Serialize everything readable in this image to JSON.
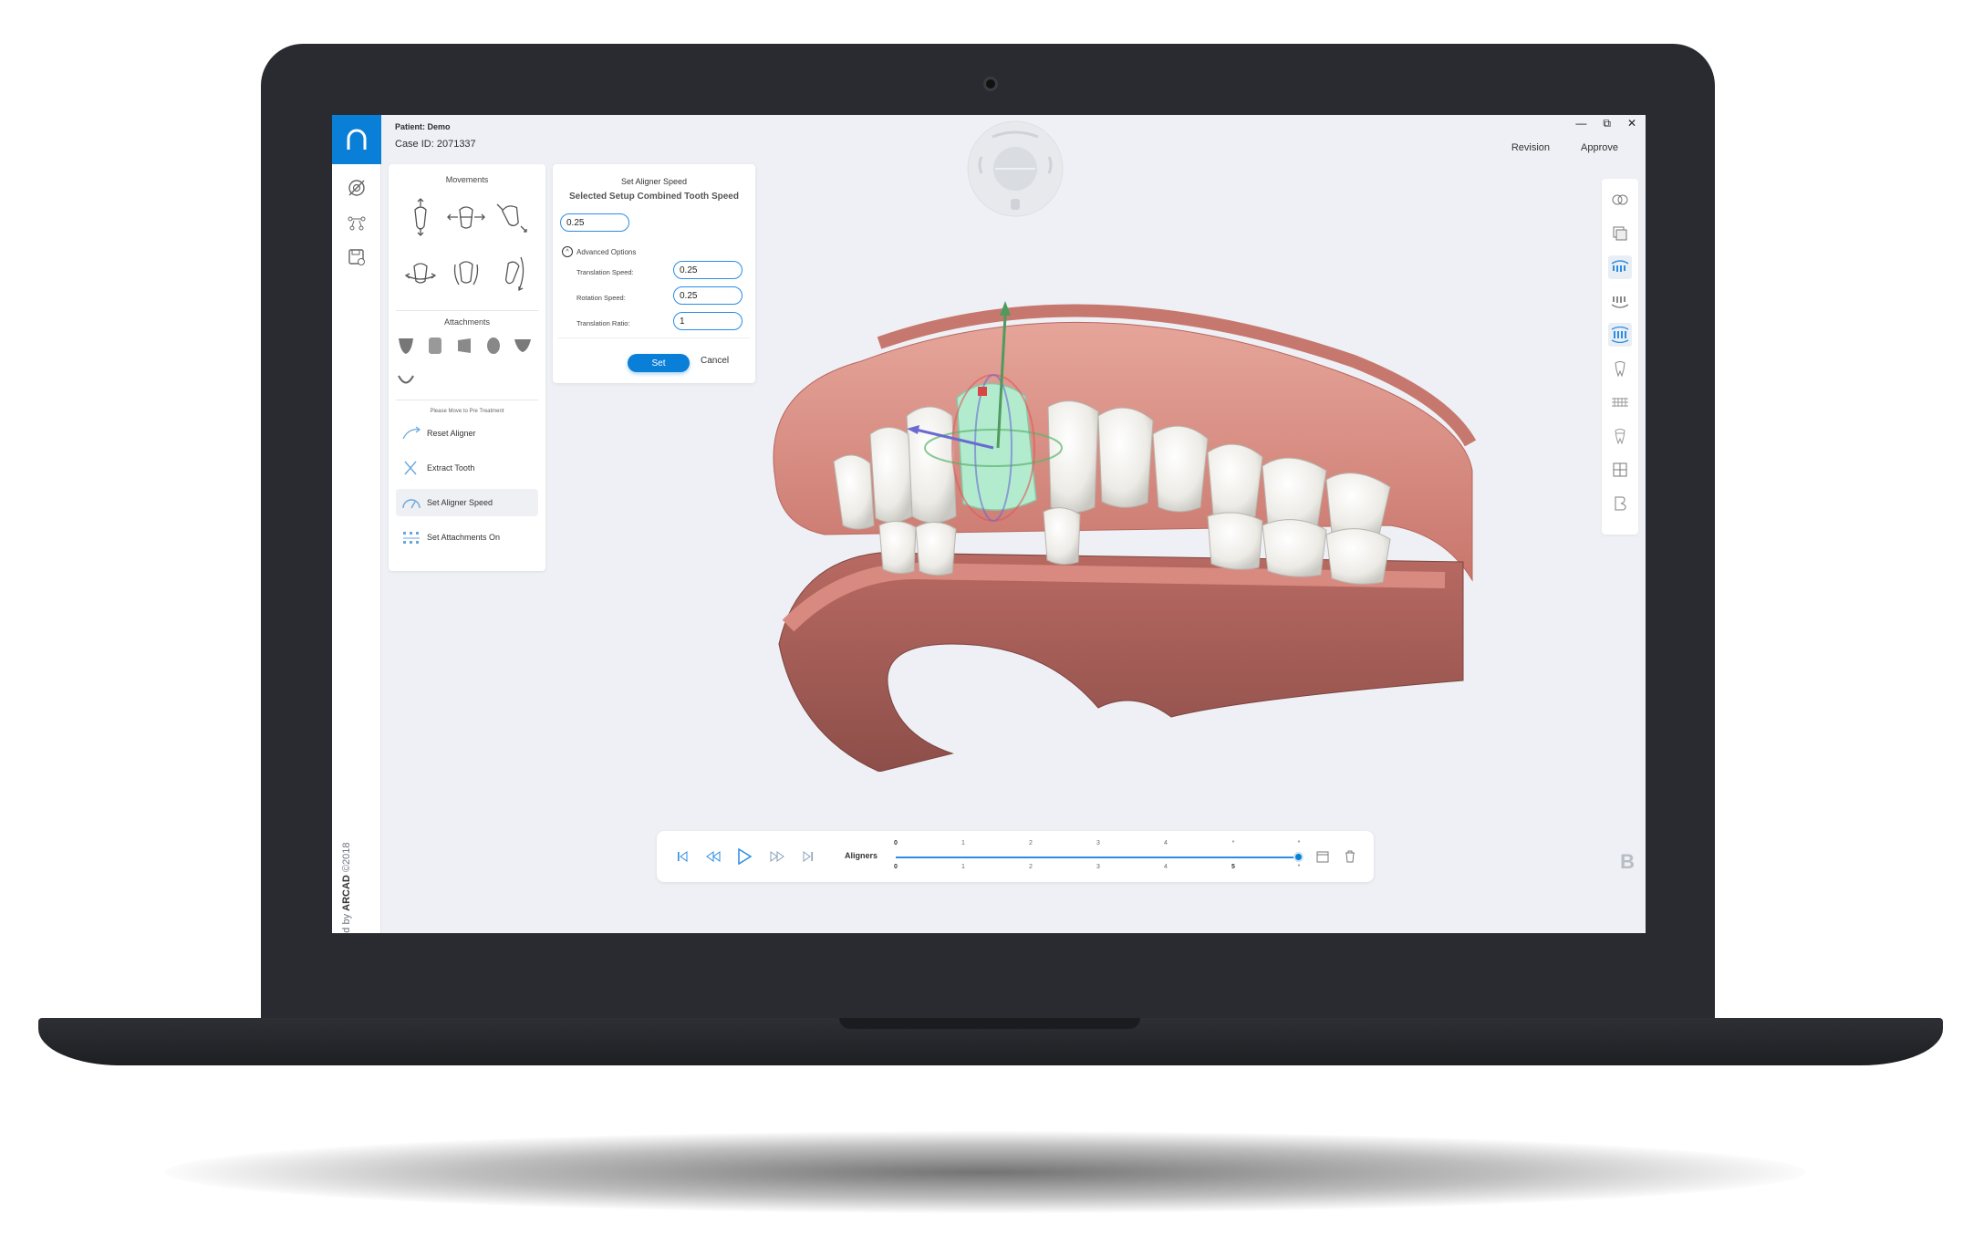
{
  "app": {
    "patient": "Patient: Demo",
    "case_id": "Case ID: 2071337",
    "powered_prefix": "Powered by ",
    "powered_brand": "ARCAD",
    "powered_suffix": " ©2018",
    "window_controls": [
      "—",
      "⧉",
      "✕"
    ],
    "actions": [
      "Revision",
      "Approve"
    ]
  },
  "left_rail": {
    "icons": [
      "no-view-icon",
      "path-nodes-icon",
      "save-settings-icon"
    ]
  },
  "tools_panel": {
    "movements_title": "Movements",
    "movements": [
      "extrusion-icon",
      "translation-icon",
      "rotation-icon",
      "tipping-icon",
      "torque-icon",
      "angulation-icon"
    ],
    "attachments_title": "Attachments",
    "attachments": [
      "attachment-ellipsoid-icon",
      "attachment-rect-icon",
      "attachment-bevel-icon",
      "attachment-oval-icon",
      "attachment-wedge-icon",
      "attachment-hook-icon"
    ],
    "pre_note": "Please Move to Pre Treatment",
    "menu": [
      {
        "label": "Reset Aligner",
        "icon": "reset-aligner-icon",
        "active": false
      },
      {
        "label": "Extract Tooth",
        "icon": "extract-tooth-icon",
        "active": false
      },
      {
        "label": "Set Aligner Speed",
        "icon": "speed-gauge-icon",
        "active": true
      },
      {
        "label": "Set Attachments On",
        "icon": "attachments-on-icon",
        "active": false
      }
    ]
  },
  "speed_dialog": {
    "title": "Set Aligner Speed",
    "subtitle": "Selected Setup Combined Tooth Speed",
    "combined_value": "0.25",
    "advanced_label": "Advanced Options",
    "fields": [
      {
        "label": "Translation Speed:",
        "value": "0.25"
      },
      {
        "label": "Rotation Speed:",
        "value": "0.25"
      },
      {
        "label": "Translation Ratio:",
        "value": "1"
      }
    ],
    "set_label": "Set",
    "cancel_label": "Cancel"
  },
  "right_toolbar": {
    "icons": [
      "overlap-icon",
      "layers-icon",
      "upper-arch-icon",
      "lower-arch-icon",
      "both-arches-icon",
      "tooth-icon",
      "arch-grid-icon",
      "tooth-outline-icon",
      "grid-icon",
      "bolton-icon"
    ],
    "active": [
      2,
      4
    ]
  },
  "timeline": {
    "label": "Aligners",
    "top_ticks": [
      "0",
      "1",
      "2",
      "3",
      "4",
      "*",
      "*"
    ],
    "bottom_ticks": [
      "0",
      "1",
      "2",
      "3",
      "4",
      "5",
      "*"
    ],
    "controls": [
      "skip-start-icon",
      "rewind-icon",
      "play-icon",
      "fast-forward-icon",
      "skip-end-icon"
    ],
    "extra": [
      "calendar-icon",
      "trash-icon"
    ]
  },
  "colors": {
    "accent": "#0a7fd8",
    "gum": "#d88a80",
    "tooth": "#f3f1ec",
    "selected_tooth": "#a8e6c6",
    "bezel": "#2a2b30"
  }
}
